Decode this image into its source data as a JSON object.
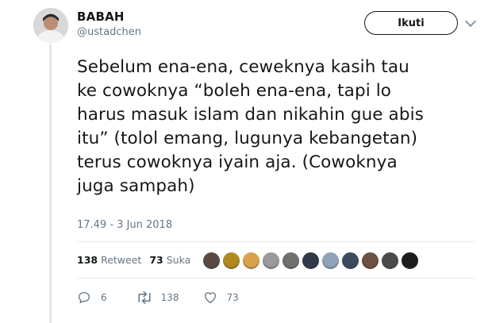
{
  "author": {
    "name": "BABAH",
    "handle": "@ustadchen",
    "follow_label": "Ikuti"
  },
  "tweet": {
    "text": "Sebelum ena-ena, ceweknya kasih tau\nke cowoknya “boleh ena-ena, tapi lo\nharus masuk islam dan nikahin gue abis\nitu” (tolol emang, lugunya kebangetan)\nterus cowoknya iyain aja. (Cowoknya\njuga sampah)",
    "timestamp": "17.49 - 3 Jun 2018"
  },
  "stats": {
    "retweet_count": "138",
    "retweet_label": "Retweet",
    "like_count": "73",
    "like_label": "Suka"
  },
  "likers": [
    {
      "icon": "liker-avatar",
      "color": "#5a4a44"
    },
    {
      "icon": "liker-avatar",
      "color": "#b08a1e"
    },
    {
      "icon": "liker-avatar",
      "color": "#d9a24a"
    },
    {
      "icon": "liker-avatar",
      "color": "#9a9a9a"
    },
    {
      "icon": "liker-avatar",
      "color": "#707070"
    },
    {
      "icon": "liker-avatar",
      "color": "#2e3a4a"
    },
    {
      "icon": "liker-avatar",
      "color": "#8fa3b8"
    },
    {
      "icon": "liker-avatar",
      "color": "#3b4b5e"
    },
    {
      "icon": "liker-avatar",
      "color": "#6a5142"
    },
    {
      "icon": "liker-avatar",
      "color": "#4a4a4a"
    },
    {
      "icon": "liker-avatar",
      "color": "#1c1c1c"
    }
  ],
  "actions": {
    "reply_count": "6",
    "retweet_count": "138",
    "like_count": "73"
  },
  "colors": {
    "text": "#14171a",
    "muted": "#657786",
    "divider": "#e6ecf0"
  }
}
